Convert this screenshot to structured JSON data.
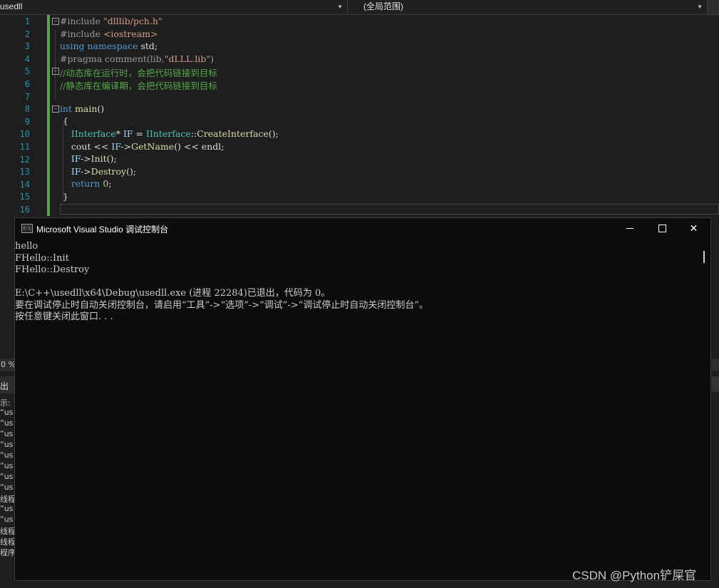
{
  "toolbar": {
    "project_dropdown": "usedll",
    "scope_dropdown": "(全局范围)"
  },
  "editor": {
    "line_numbers": [
      "1",
      "2",
      "3",
      "4",
      "5",
      "6",
      "7",
      "8",
      "9",
      "10",
      "11",
      "12",
      "13",
      "14",
      "15",
      "16"
    ]
  },
  "left_panel": {
    "zoom": "0 %",
    "tab": "出",
    "lines": [
      "示:",
      "“us",
      "“us",
      "“us",
      "“us",
      "“us",
      "“us",
      "“us",
      "“us",
      "线程",
      "“us",
      "“us",
      "线程",
      "线程",
      "程序"
    ]
  },
  "console": {
    "title": "Microsoft Visual Studio 调试控制台",
    "icon_text": "C:\\",
    "output_lines": [
      "hello",
      "FHello::Init",
      "FHello::Destroy",
      "",
      "E:\\C++\\usedll\\x64\\Debug\\usedll.exe (进程 22284)已退出，代码为 0。",
      "要在调试停止时自动关闭控制台，请启用“工具”->“选项”->“调试”->“调试停止时自动关闭控制台”。",
      "按任意键关闭此窗口. . ."
    ]
  },
  "watermark": "CSDN @Python铲屎官"
}
